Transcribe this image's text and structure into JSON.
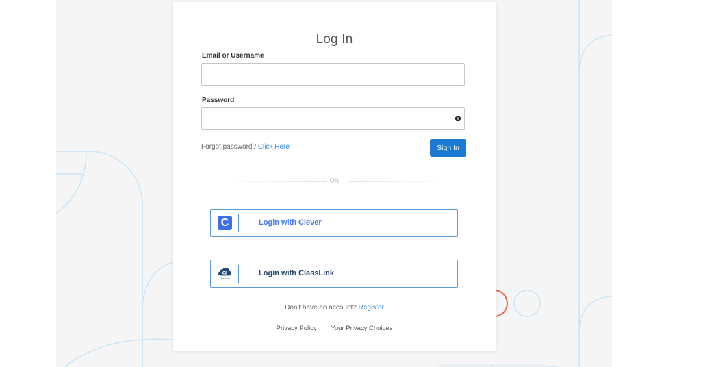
{
  "login": {
    "title": "Log In",
    "email_label": "Email or Username",
    "email_value": "",
    "password_label": "Password",
    "password_value": "",
    "show_password_icon": "eye-icon",
    "forgot_text": "Forgot password?",
    "forgot_link": "Click Here",
    "signin_label": "Sign In",
    "or_label": "OR"
  },
  "sso": [
    {
      "label": "Login with Clever",
      "icon": "clever-logo",
      "logo_glyph": "C",
      "text_color": "#4a7be8"
    },
    {
      "label": "Login with ClassLink",
      "icon": "classlink-logo",
      "logo_caption": "ClassLink",
      "text_color": "#2d4a6b"
    }
  ],
  "register": {
    "text": "Don't have an account?",
    "link": "Register"
  },
  "footer": {
    "privacy_policy": "Privacy Policy",
    "privacy_choices": "Your Privacy Choices"
  },
  "colors": {
    "primary": "#1a7ad4",
    "link": "#3a8ed6",
    "sso_border": "#5b9bd5",
    "decor_line": "#c9e4f5",
    "decor_accent": "#e8624a",
    "background": "#f5f5f5"
  }
}
